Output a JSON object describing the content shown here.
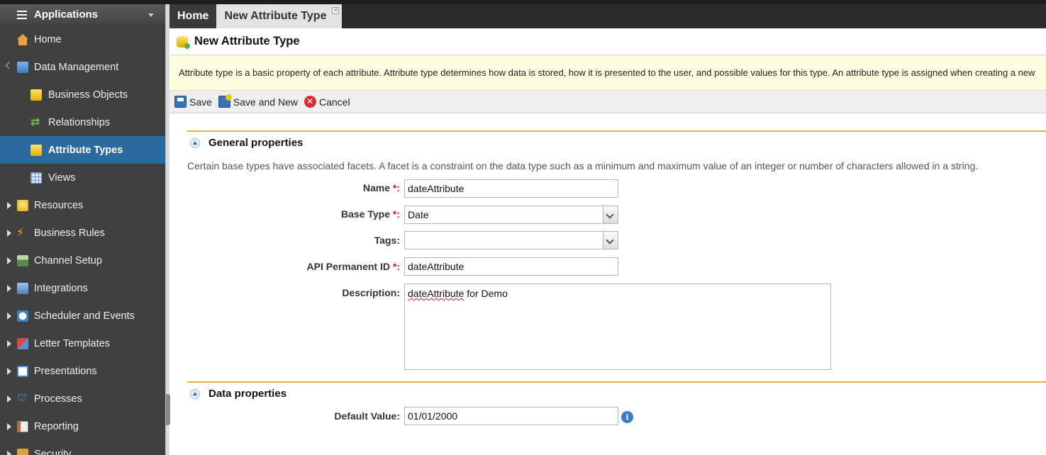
{
  "sidebar": {
    "header": "Applications",
    "items": [
      {
        "label": "Home",
        "icon": "home-icon"
      },
      {
        "label": "Data Management",
        "icon": "database-icon"
      },
      {
        "label": "Business Objects",
        "icon": "business-objects-icon"
      },
      {
        "label": "Relationships",
        "icon": "relationships-icon"
      },
      {
        "label": "Attribute Types",
        "icon": "attribute-types-icon",
        "active": true
      },
      {
        "label": "Views",
        "icon": "views-icon"
      },
      {
        "label": "Resources",
        "icon": "lightbulb-icon"
      },
      {
        "label": "Business Rules",
        "icon": "lightning-icon"
      },
      {
        "label": "Channel Setup",
        "icon": "channel-icon"
      },
      {
        "label": "Integrations",
        "icon": "integrations-icon"
      },
      {
        "label": "Scheduler and Events",
        "icon": "clock-icon"
      },
      {
        "label": "Letter Templates",
        "icon": "letter-icon"
      },
      {
        "label": "Presentations",
        "icon": "presentation-icon"
      },
      {
        "label": "Processes",
        "icon": "process-icon"
      },
      {
        "label": "Reporting",
        "icon": "report-icon"
      },
      {
        "label": "Security",
        "icon": "security-icon"
      }
    ]
  },
  "tabs": [
    {
      "label": "Home"
    },
    {
      "label": "New Attribute Type"
    }
  ],
  "page": {
    "title": "New Attribute Type",
    "banner": "Attribute type is a basic property of each attribute. Attribute type determines how data is stored, how it is presented to the user, and possible values for this type. An attribute type is assigned when creating a new"
  },
  "toolbar": {
    "save_label": "Save",
    "save_new_label": "Save and New",
    "cancel_label": "Cancel"
  },
  "general": {
    "title": "General properties",
    "note": "Certain base types have associated facets. A facet is a constraint on the data type such as a minimum and maximum value of an integer or number of characters allowed in a string.",
    "name_label": "Name",
    "name_value": "dateAttribute",
    "base_type_label": "Base Type",
    "base_type_value": "Date",
    "tags_label": "Tags:",
    "tags_value": "",
    "api_id_label": "API Permanent ID",
    "api_id_value": "dateAttribute",
    "description_label": "Description:",
    "description_word1": "dateAttribute",
    "description_rest": " for Demo",
    "required_mark": "*:"
  },
  "data_props": {
    "title": "Data properties",
    "default_label": "Default Value:",
    "default_value": "01/01/2000",
    "info_glyph": "i"
  },
  "colors": {
    "sidebar_bg": "#404040",
    "active_item": "#2b6aa0",
    "section_rule": "#f0b030",
    "banner_bg": "#fdfde0",
    "required": "#d02020"
  }
}
